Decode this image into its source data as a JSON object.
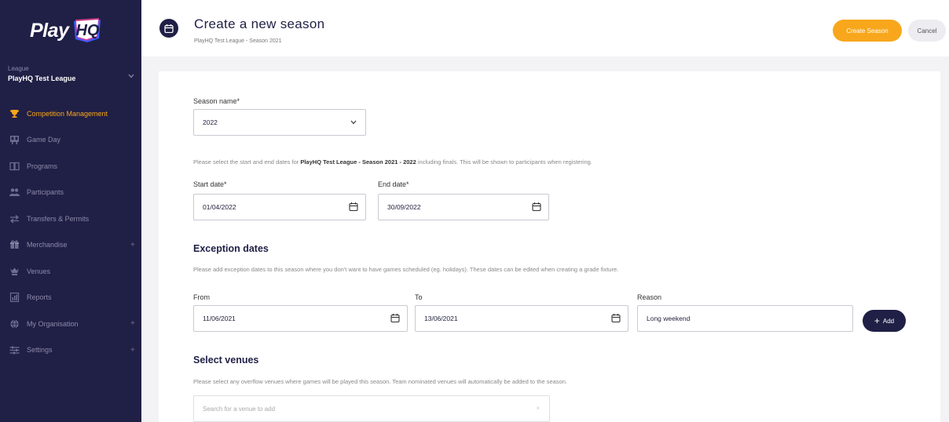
{
  "app": {
    "logo_text": "Play",
    "logo_badge": "HQ"
  },
  "sidebar": {
    "league_label": "League",
    "league_name": "PlayHQ Test League",
    "items": [
      {
        "label": "Competition Management",
        "icon": "trophy-icon",
        "active": true,
        "expandable": false
      },
      {
        "label": "Game Day",
        "icon": "scoreboard-icon",
        "active": false,
        "expandable": false
      },
      {
        "label": "Programs",
        "icon": "book-icon",
        "active": false,
        "expandable": false
      },
      {
        "label": "Participants",
        "icon": "people-icon",
        "active": false,
        "expandable": false
      },
      {
        "label": "Transfers & Permits",
        "icon": "transfer-icon",
        "active": false,
        "expandable": false
      },
      {
        "label": "Merchandise",
        "icon": "gift-icon",
        "active": false,
        "expandable": true
      },
      {
        "label": "Venues",
        "icon": "venue-icon",
        "active": false,
        "expandable": false
      },
      {
        "label": "Reports",
        "icon": "report-icon",
        "active": false,
        "expandable": false
      },
      {
        "label": "My Organisation",
        "icon": "globe-icon",
        "active": false,
        "expandable": true
      },
      {
        "label": "Settings",
        "icon": "sliders-icon",
        "active": false,
        "expandable": true
      }
    ],
    "expand_symbol": "+"
  },
  "header": {
    "title": "Create a new season",
    "subtitle": "PlayHQ Test League - Season 2021",
    "create_label": "Create Season",
    "cancel_label": "Cancel"
  },
  "form": {
    "season_name_label": "Season name*",
    "season_name_value": "2022",
    "dates_help_prefix": "Please select the start and end dates for",
    "dates_help_bold": "PlayHQ Test League - Season 2021 - 2022",
    "dates_help_suffix": "including finals. This will be shown to participants when registering.",
    "start_date_label": "Start date*",
    "start_date_value": "01/04/2022",
    "end_date_label": "End date*",
    "end_date_value": "30/09/2022",
    "exception_title": "Exception dates",
    "exception_help": "Please add exception dates to this season where you don't want to have games scheduled (eg. holidays). These dates can be edited when creating a grade fixture.",
    "from_label": "From",
    "from_value": "11/06/2021",
    "to_label": "To",
    "to_value": "13/06/2021",
    "reason_label": "Reason",
    "reason_value": "Long weekend",
    "add_label": "Add",
    "add_symbol": "+",
    "venues_title": "Select venues",
    "venues_help": "Please select any overflow venues where games will be played this season. Team nominated venues will automatically be added to the season.",
    "venue_search_placeholder": "Search for a venue to add",
    "venue_search_clear": "×"
  },
  "colors": {
    "sidebar_bg": "#201f46",
    "accent": "#f8a71c",
    "logo_blue": "#3d5afe",
    "logo_pink": "#e8408c"
  }
}
